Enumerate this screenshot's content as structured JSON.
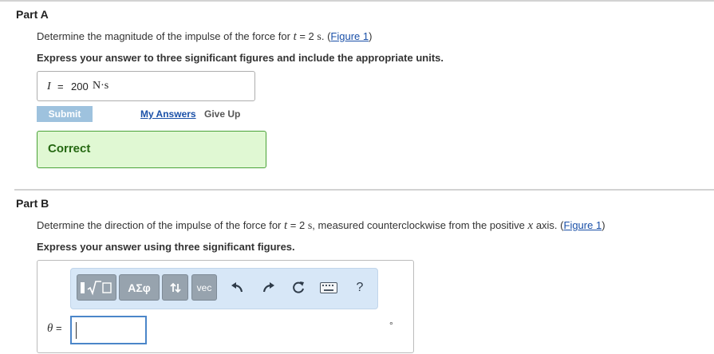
{
  "partA": {
    "heading": "Part A",
    "question_prefix": "Determine the magnitude of the impulse of the force for ",
    "question_var": "t",
    "question_eq": " = 2 ",
    "question_unit": "s",
    "question_suffix": ". (",
    "figure_link": "Figure 1",
    "question_close": ")",
    "instructions": "Express your answer to three significant figures and include the appropriate units.",
    "answer": {
      "variable": "I",
      "equals": "=",
      "value": "200",
      "units": "N·s"
    },
    "submit_label": "Submit",
    "my_answers_label": "My Answers",
    "give_up_label": "Give Up",
    "feedback": "Correct",
    "colors": {
      "submit": "#9ec2de",
      "correct_bg": "#e0f8d3",
      "correct_border": "#4aa238",
      "link": "#1a50a8"
    }
  },
  "partB": {
    "heading": "Part B",
    "question_prefix": "Determine the direction of the impulse of the force for ",
    "question_var": "t",
    "question_eq": " = 2 ",
    "question_unit": "s",
    "question_mid": ", measured counterclockwise from the positive ",
    "question_axis": "x",
    "question_suffix": " axis. (",
    "figure_link": "Figure 1",
    "question_close": ")",
    "instructions": "Express your answer using three significant figures.",
    "toolbar": {
      "templates_icon": "sqrt-template-icon",
      "greek_label": "ΑΣφ",
      "arrows_icon": "up-down-arrows-icon",
      "vec_label": "vec",
      "undo_icon": "undo-icon",
      "redo_icon": "redo-icon",
      "reset_icon": "reset-icon",
      "keyboard_icon": "keyboard-icon",
      "help_label": "?"
    },
    "input_label_var": "θ",
    "input_label_eq": " =",
    "input_value": "",
    "unit_symbol": "°"
  }
}
